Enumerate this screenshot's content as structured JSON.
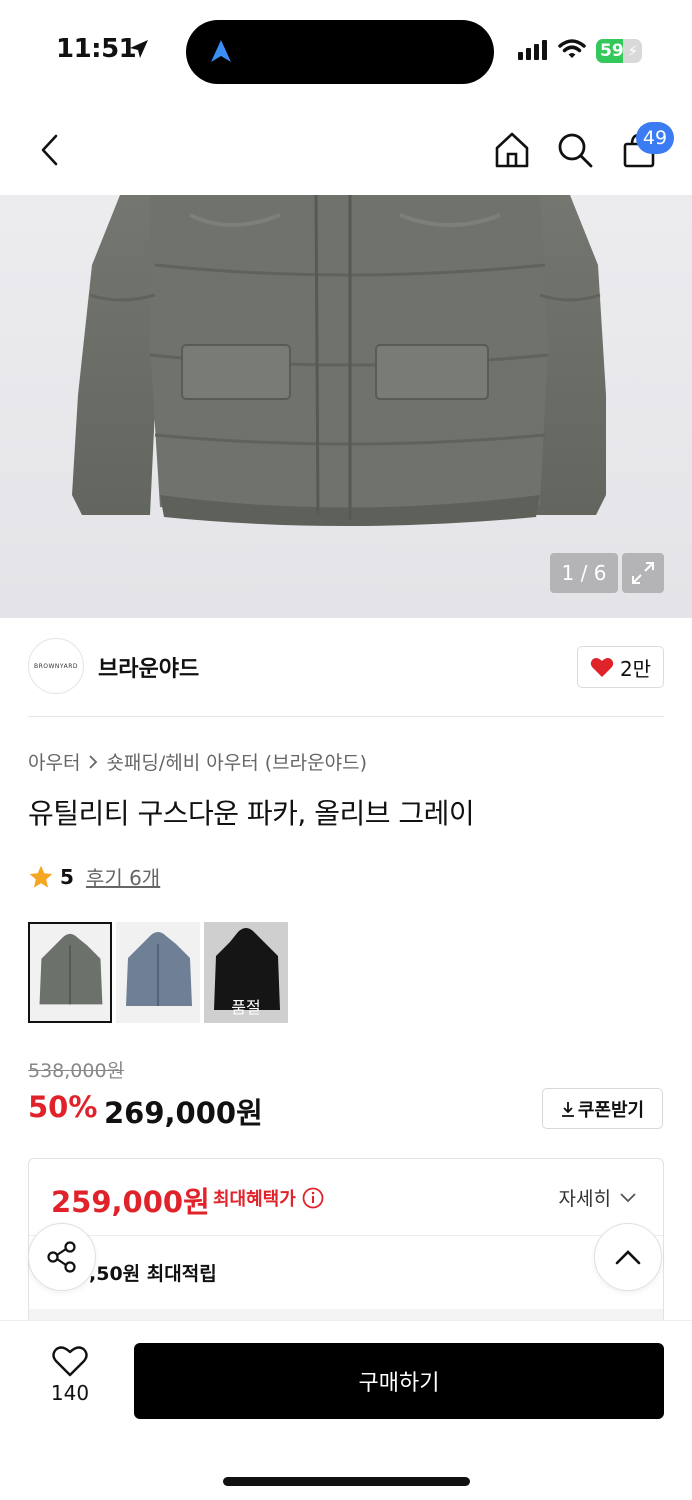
{
  "status_bar": {
    "time": "11:51",
    "battery": "59",
    "battery_level": 0.59
  },
  "nav": {
    "cart_count": "49"
  },
  "gallery": {
    "counter": "1 / 6"
  },
  "brand": {
    "logo_text": "BROWNYARD",
    "name": "브라운야드",
    "likes": "2만"
  },
  "product": {
    "breadcrumb": [
      "아우터",
      "숏패딩/헤비 아우터 (브라운야드)"
    ],
    "title": "유틸리티 구스다운 파카, 올리브 그레이",
    "rating": "5",
    "reviews": "후기 6개",
    "swatches": [
      {
        "color": "#6c716c",
        "soldout_label": ""
      },
      {
        "color": "#6f7f96",
        "soldout_label": ""
      },
      {
        "color": "#151515",
        "soldout_label": "품절"
      }
    ],
    "original_price": "538,000원",
    "discount": "50%",
    "sale_price": "269,000원",
    "coupon_label": "쿠폰받기"
  },
  "benefit": {
    "max_price": "259,000원",
    "max_label": "최대혜택가",
    "detail_label": "자세히",
    "points": ",50원 최대적립"
  },
  "bottom": {
    "wish_count": "140",
    "buy_label": "구매하기"
  },
  "colors": {
    "accent_red": "#e0232a",
    "badge_blue": "#3b7cf5",
    "jacket": "#6b6f6b"
  }
}
